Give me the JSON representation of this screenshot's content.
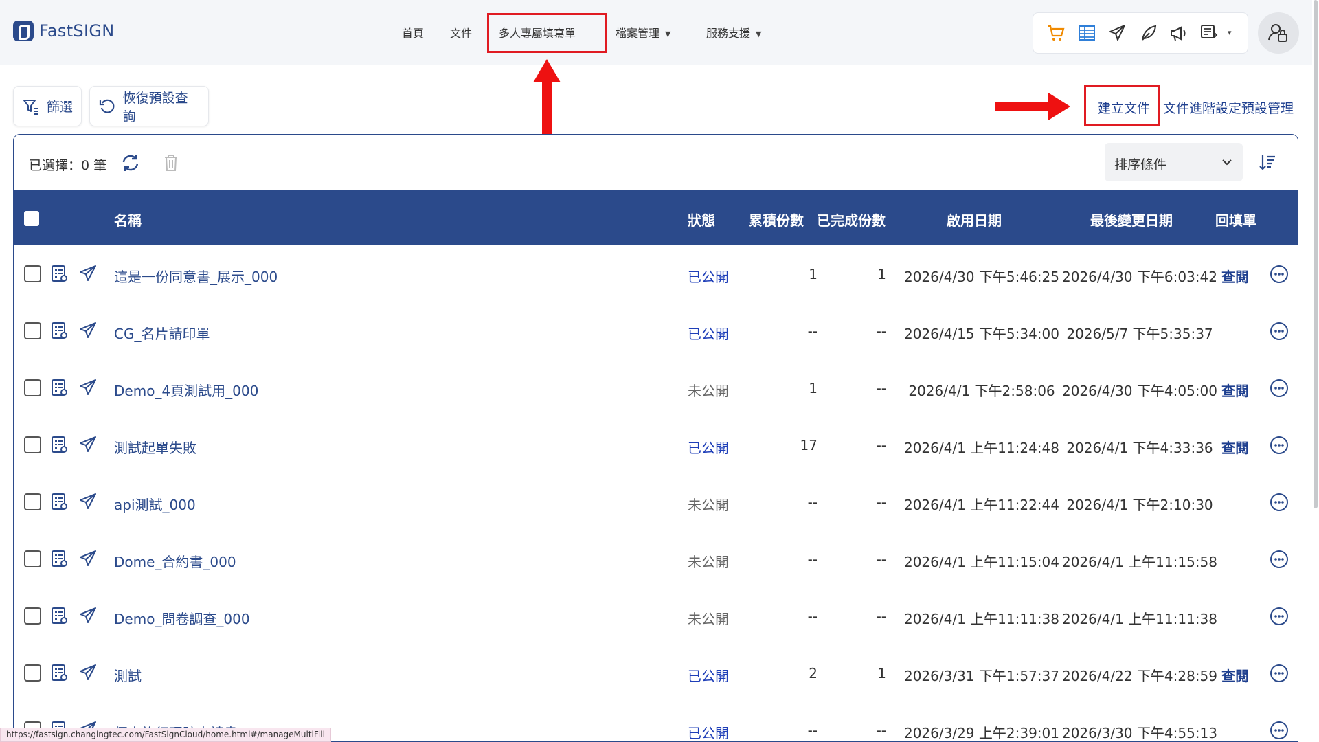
{
  "app": {
    "brand": "FastSIGN"
  },
  "nav": {
    "items": [
      {
        "label": "首頁",
        "has_caret": false
      },
      {
        "label": "文件",
        "has_caret": false
      },
      {
        "label": "多人專屬填寫單",
        "has_caret": false,
        "highlighted": true
      },
      {
        "label": "檔案管理",
        "has_caret": true
      },
      {
        "label": "服務支援",
        "has_caret": true
      }
    ],
    "tool_icons": [
      "cart-icon",
      "table-icon",
      "send-icon",
      "feather-icon",
      "megaphone-icon",
      "note-icon"
    ]
  },
  "toolbar": {
    "filter_label": "篩選",
    "reset_label": "恢復預設查詢",
    "create_label": "建立文件",
    "manage_label": "文件進階設定預設管理"
  },
  "list": {
    "selected_text": "已選擇：0 筆",
    "sort_placeholder": "排序條件",
    "headers": {
      "name": "名稱",
      "status": "狀態",
      "total": "累積份數",
      "done": "已完成份數",
      "start": "啟用日期",
      "modified": "最後變更日期",
      "reply": "回填單"
    },
    "rows": [
      {
        "name": "這是一份同意書_展示_000",
        "status": "已公開",
        "published": true,
        "total": "1",
        "done": "1",
        "start": "2026/4/30 下午5:46:25",
        "modified": "2026/4/30 下午6:03:42",
        "reply": "查閱"
      },
      {
        "name": "CG_名片請印單",
        "status": "已公開",
        "published": true,
        "total": "--",
        "done": "--",
        "start": "2026/4/15 下午5:34:00",
        "modified": "2026/5/7 下午5:35:37",
        "reply": ""
      },
      {
        "name": "Demo_4頁測試用_000",
        "status": "未公開",
        "published": false,
        "total": "1",
        "done": "--",
        "start": "2026/4/1 下午2:58:06",
        "modified": "2026/4/30 下午4:05:00",
        "reply": "查閱"
      },
      {
        "name": "測試起單失敗",
        "status": "已公開",
        "published": true,
        "total": "17",
        "done": "--",
        "start": "2026/4/1 上午11:24:48",
        "modified": "2026/4/1 下午4:33:36",
        "reply": "查閱"
      },
      {
        "name": "api測試_000",
        "status": "未公開",
        "published": false,
        "total": "--",
        "done": "--",
        "start": "2026/4/1 上午11:22:44",
        "modified": "2026/4/1 下午2:10:30",
        "reply": ""
      },
      {
        "name": "Dome_合約書_000",
        "status": "未公開",
        "published": false,
        "total": "--",
        "done": "--",
        "start": "2026/4/1 上午11:15:04",
        "modified": "2026/4/1 上午11:15:58",
        "reply": ""
      },
      {
        "name": "Demo_問卷調查_000",
        "status": "未公開",
        "published": false,
        "total": "--",
        "done": "--",
        "start": "2026/4/1 上午11:11:38",
        "modified": "2026/4/1 上午11:11:38",
        "reply": ""
      },
      {
        "name": "測試",
        "status": "已公開",
        "published": true,
        "total": "2",
        "done": "1",
        "start": "2026/3/31 下午1:57:37",
        "modified": "2026/4/22 下午4:28:59",
        "reply": "查閱"
      },
      {
        "name": "個人旅行理賠申請書",
        "status": "已公開",
        "published": true,
        "total": "--",
        "done": "--",
        "start": "2026/3/29 上午2:39:01",
        "modified": "2026/3/30 下午4:55:13",
        "reply": ""
      }
    ]
  },
  "statusbar": {
    "url": "https://fastsign.changingtec.com/FastSignCloud/home.html#/manageMultiFill"
  },
  "colors": {
    "brand": "#2b4a8b",
    "highlight": "#e01b22",
    "published": "#1f3fb8"
  }
}
